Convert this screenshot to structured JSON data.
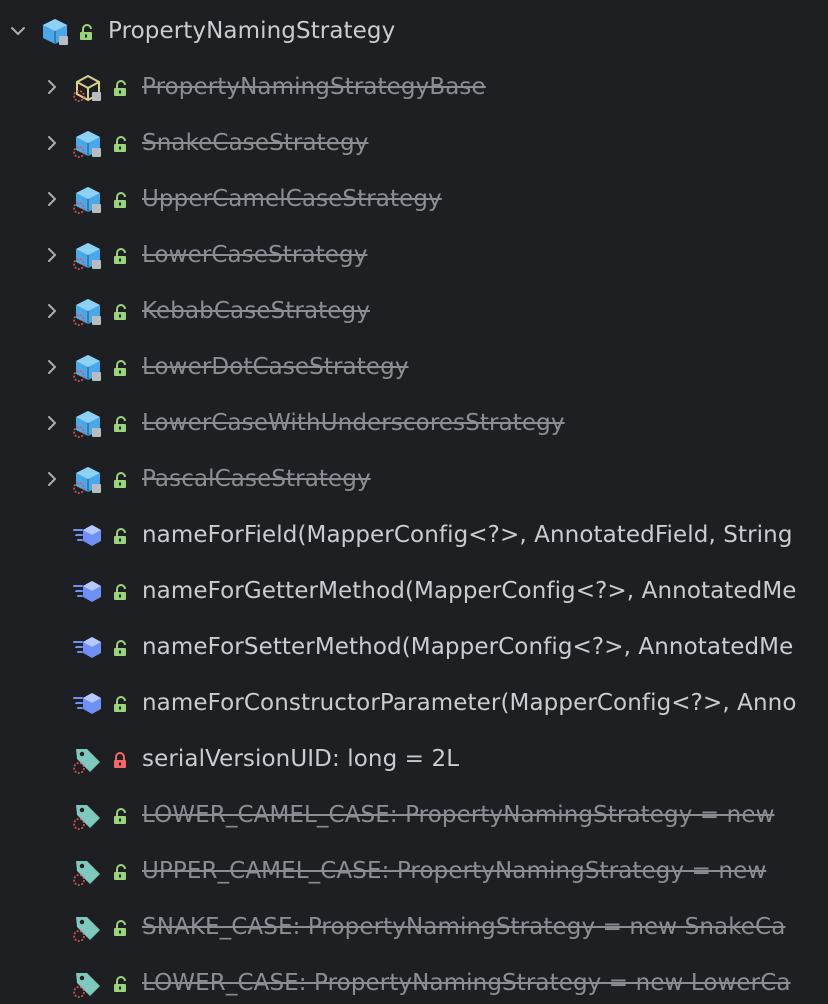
{
  "root": {
    "label": "PropertyNamingStrategy",
    "expanded": true,
    "icon": "class-icon",
    "access": "public"
  },
  "children": [
    {
      "label": "PropertyNamingStrategyBase",
      "icon": "abstract-class-icon",
      "access": "public",
      "deprecated": true,
      "expandable": true
    },
    {
      "label": "SnakeCaseStrategy",
      "icon": "class-icon",
      "access": "public",
      "deprecated": true,
      "expandable": true
    },
    {
      "label": "UpperCamelCaseStrategy",
      "icon": "class-icon",
      "access": "public",
      "deprecated": true,
      "expandable": true
    },
    {
      "label": "LowerCaseStrategy",
      "icon": "class-icon",
      "access": "public",
      "deprecated": true,
      "expandable": true
    },
    {
      "label": "KebabCaseStrategy",
      "icon": "class-icon",
      "access": "public",
      "deprecated": true,
      "expandable": true
    },
    {
      "label": "LowerDotCaseStrategy",
      "icon": "class-icon",
      "access": "public",
      "deprecated": true,
      "expandable": true
    },
    {
      "label": "LowerCaseWithUnderscoresStrategy",
      "icon": "class-icon",
      "access": "public",
      "deprecated": true,
      "expandable": true
    },
    {
      "label": "PascalCaseStrategy",
      "icon": "class-icon",
      "access": "public",
      "deprecated": true,
      "expandable": true
    },
    {
      "label": "nameForField(MapperConfig<?>, AnnotatedField, String",
      "icon": "method-icon",
      "access": "public",
      "deprecated": false,
      "expandable": false
    },
    {
      "label": "nameForGetterMethod(MapperConfig<?>, AnnotatedMe",
      "icon": "method-icon",
      "access": "public",
      "deprecated": false,
      "expandable": false
    },
    {
      "label": "nameForSetterMethod(MapperConfig<?>, AnnotatedMe",
      "icon": "method-icon",
      "access": "public",
      "deprecated": false,
      "expandable": false
    },
    {
      "label": "nameForConstructorParameter(MapperConfig<?>, Anno",
      "icon": "method-icon",
      "access": "public",
      "deprecated": false,
      "expandable": false
    },
    {
      "label": "serialVersionUID: long = 2L",
      "icon": "field-icon",
      "access": "private",
      "deprecated": false,
      "expandable": false
    },
    {
      "label": "LOWER_CAMEL_CASE: PropertyNamingStrategy = new",
      "icon": "field-icon",
      "access": "public",
      "deprecated": true,
      "expandable": false
    },
    {
      "label": "UPPER_CAMEL_CASE: PropertyNamingStrategy = new",
      "icon": "field-icon",
      "access": "public",
      "deprecated": true,
      "expandable": false
    },
    {
      "label": "SNAKE_CASE: PropertyNamingStrategy = new SnakeCa",
      "icon": "field-icon",
      "access": "public",
      "deprecated": true,
      "expandable": false
    },
    {
      "label": "LOWER_CASE: PropertyNamingStrategy = new LowerCa",
      "icon": "field-icon",
      "access": "public",
      "deprecated": true,
      "expandable": false
    }
  ],
  "colors": {
    "background": "#1e1f22",
    "text": "#c9ccd3",
    "deprecated_text": "#8a8d94",
    "class_blue": "#4aa8e8",
    "abstract_yellow": "#d8d48a",
    "method_blue": "#6f8ff5",
    "field_teal": "#7fc8bd",
    "lock_public": "#9bd27a",
    "lock_private": "#f06868",
    "static_red": "#e05555"
  }
}
